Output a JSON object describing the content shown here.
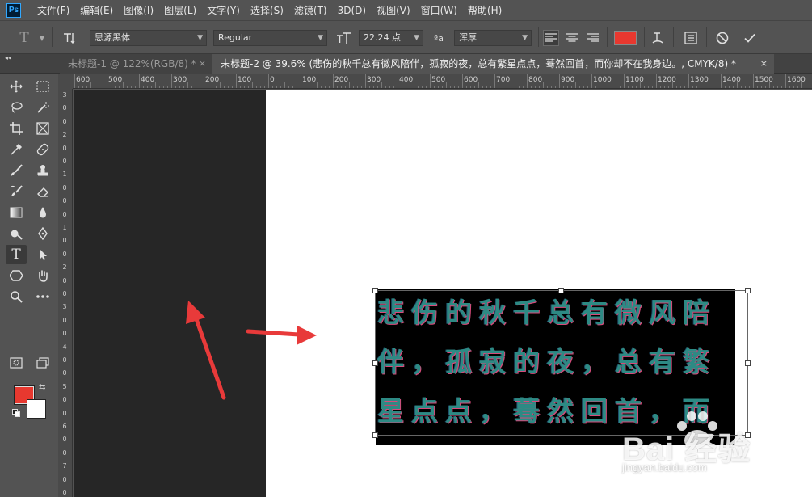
{
  "menubar": {
    "logo": "Ps",
    "items": [
      "文件(F)",
      "编辑(E)",
      "图像(I)",
      "图层(L)",
      "文字(Y)",
      "选择(S)",
      "滤镜(T)",
      "3D(D)",
      "视图(V)",
      "窗口(W)",
      "帮助(H)"
    ]
  },
  "options": {
    "tool_icon": "T",
    "font_family": "思源黑体",
    "font_style": "Regular",
    "font_size": "22.24 点",
    "antialias_label": "ªa",
    "antialias": "浑厚",
    "text_color": "#e8382f"
  },
  "tabs": [
    {
      "label": "未标题-1 @ 122%(RGB/8) *",
      "active": false
    },
    {
      "label": "未标题-2 @ 39.6% (悲伤的秋千总有微风陪伴，孤寂的夜，总有繁星点点，蓦然回首，而你却不在我身边。, CMYK/8) *",
      "active": true
    }
  ],
  "tab_close": "×",
  "panel_collapse": "◂◂",
  "toolbar": {
    "foreground": "#e8382f",
    "background": "#ffffff"
  },
  "ruler": {
    "top_labels": [
      "600",
      "500",
      "400",
      "300",
      "200",
      "100",
      "0",
      "100",
      "200",
      "300",
      "400",
      "500",
      "600",
      "700",
      "800",
      "900",
      "1000",
      "1100",
      "1200",
      "1300",
      "1400",
      "1500",
      "1600"
    ],
    "left_labels": [
      "3",
      "0",
      "0",
      "2",
      "0",
      "0",
      "1",
      "0",
      "0",
      "0",
      "1",
      "0",
      "0",
      "2",
      "0",
      "0",
      "3",
      "0",
      "0",
      "4",
      "0",
      "0",
      "5",
      "0",
      "0",
      "6",
      "0",
      "0",
      "7",
      "0",
      "0"
    ]
  },
  "canvas_text": {
    "lines": [
      "悲伤的秋千总有微风陪",
      "伴，孤寂的夜，总有繁",
      "星点点，蓦然回首，而"
    ],
    "color": "#2d8a84"
  },
  "watermark": {
    "logo": "Bai 经验",
    "url": "jingyan.baidu.com"
  }
}
